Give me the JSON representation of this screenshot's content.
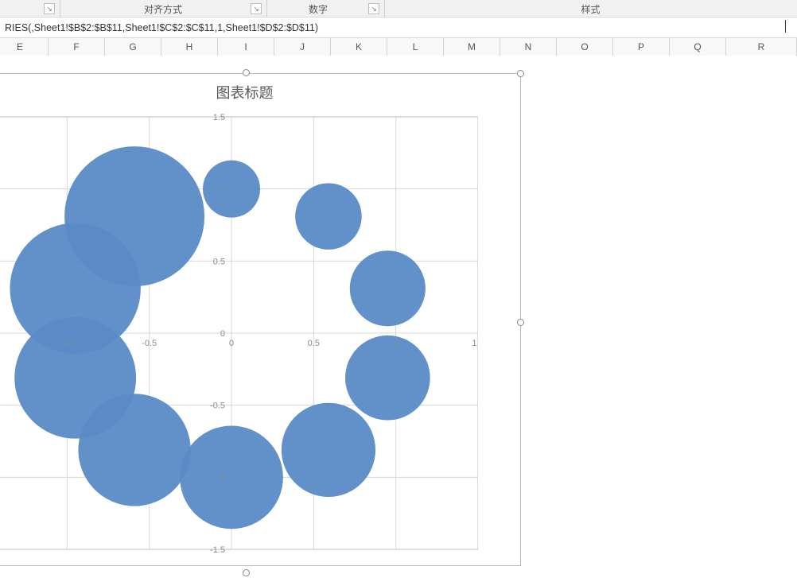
{
  "ribbon": {
    "group_alignment": "对齐方式",
    "group_number": "数字",
    "group_styles": "样式"
  },
  "formula_bar": {
    "value": "RIES(,Sheet1!$B$2:$B$11,Sheet1!$C$2:$C$11,1,Sheet1!$D$2:$D$11)"
  },
  "columns": [
    "E",
    "F",
    "G",
    "H",
    "I",
    "J",
    "K",
    "L",
    "M",
    "N",
    "O",
    "P",
    "Q",
    "R"
  ],
  "chart": {
    "title": "图表标题"
  },
  "chart_data": {
    "type": "bubble",
    "title": "图表标题",
    "xlabel": "",
    "ylabel": "",
    "xlim": [
      -1.5,
      1.5
    ],
    "ylim": [
      -1.5,
      1.5
    ],
    "x_ticks": [
      -1,
      -0.5,
      0,
      0.5,
      1,
      1.5
    ],
    "y_ticks": [
      -1.5,
      -1,
      -0.5,
      0,
      0.5,
      1,
      1.5
    ],
    "series": [
      {
        "name": "",
        "points": [
          {
            "x": 0.0,
            "y": 1.0,
            "size": 1
          },
          {
            "x": 0.59,
            "y": 0.81,
            "size": 2
          },
          {
            "x": 0.95,
            "y": 0.31,
            "size": 3
          },
          {
            "x": 0.95,
            "y": -0.31,
            "size": 4
          },
          {
            "x": 0.59,
            "y": -0.81,
            "size": 5
          },
          {
            "x": 0.0,
            "y": -1.0,
            "size": 6
          },
          {
            "x": -0.59,
            "y": -0.81,
            "size": 7
          },
          {
            "x": -0.95,
            "y": -0.31,
            "size": 8
          },
          {
            "x": -0.95,
            "y": 0.31,
            "size": 9
          },
          {
            "x": -0.59,
            "y": 0.81,
            "size": 10
          }
        ]
      }
    ]
  }
}
